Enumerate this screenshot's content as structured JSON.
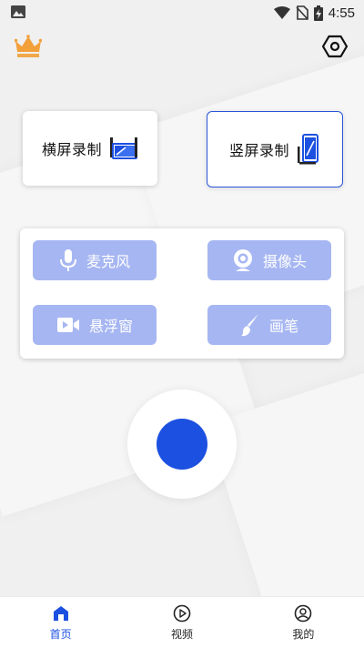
{
  "status_bar": {
    "time": "4:55",
    "icons": [
      "image-icon",
      "wifi-icon",
      "no-sim-icon",
      "battery-charging-icon"
    ]
  },
  "top_bar": {
    "left_icon": "crown-icon",
    "right_icon": "settings-icon"
  },
  "record_modes": [
    {
      "label": "横屏录制",
      "icon": "landscape-screen-icon",
      "selected": false
    },
    {
      "label": "竖屏录制",
      "icon": "portrait-phone-icon",
      "selected": true
    }
  ],
  "options": [
    {
      "label": "麦克风",
      "icon": "microphone-icon"
    },
    {
      "label": "摄像头",
      "icon": "camera-icon"
    },
    {
      "label": "悬浮窗",
      "icon": "video-camera-icon"
    },
    {
      "label": "画笔",
      "icon": "brush-icon"
    }
  ],
  "record_button": {
    "icon": "record-dot"
  },
  "bottom_nav": [
    {
      "label": "首页",
      "icon": "home-icon",
      "active": true
    },
    {
      "label": "视频",
      "icon": "play-circle-icon",
      "active": false
    },
    {
      "label": "我的",
      "icon": "user-icon",
      "active": false
    }
  ],
  "colors": {
    "accent": "#1c50e0",
    "option_bg": "#a6b6f2",
    "crown": "#f2a03a"
  }
}
